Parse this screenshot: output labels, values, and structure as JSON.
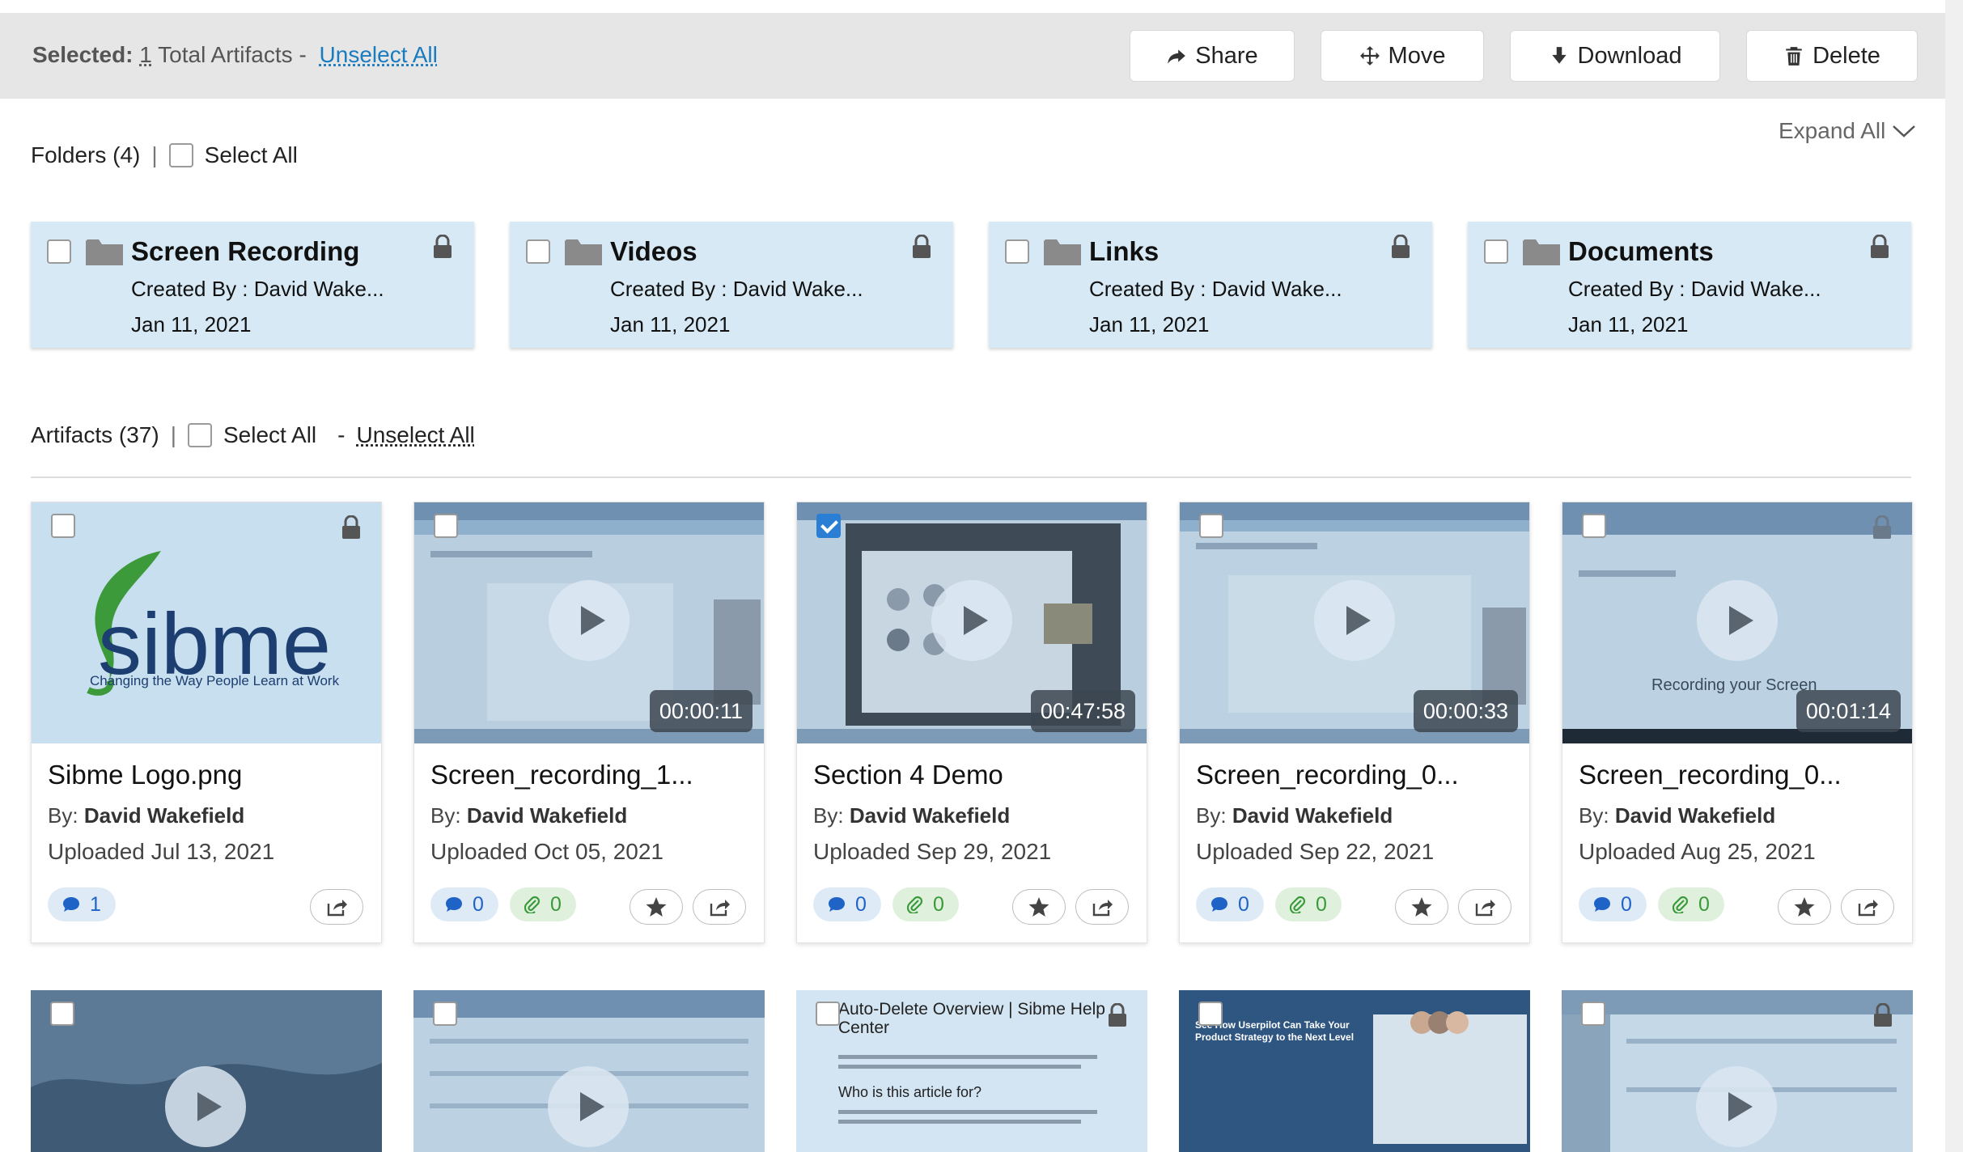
{
  "selection": {
    "label": "Selected:",
    "count": "1",
    "total_text": "Total Artifacts",
    "dash": "-",
    "unselect_all": "Unselect All",
    "actions": [
      {
        "label": "Share",
        "icon": "share-arrow-icon"
      },
      {
        "label": "Move",
        "icon": "move-arrows-icon"
      },
      {
        "label": "Download",
        "icon": "download-arrow-icon"
      },
      {
        "label": "Delete",
        "icon": "trash-icon"
      }
    ]
  },
  "folders_section": {
    "label": "Folders (4)",
    "select_all": "Select All",
    "expand_all": "Expand All",
    "folders": [
      {
        "title": "Screen Recording",
        "created_by": "Created By : David Wake...",
        "date": "Jan 11, 2021"
      },
      {
        "title": "Videos",
        "created_by": "Created By : David Wake...",
        "date": "Jan 11, 2021"
      },
      {
        "title": "Links",
        "created_by": "Created By : David Wake...",
        "date": "Jan 11, 2021"
      },
      {
        "title": "Documents",
        "created_by": "Created By : David Wake...",
        "date": "Jan 11, 2021"
      }
    ]
  },
  "artifacts_section": {
    "label": "Artifacts (37)",
    "select_all": "Select All",
    "dash": "-",
    "unselect_all": "Unselect All",
    "by_prefix": "By:",
    "cards": [
      {
        "title": "Sibme Logo.png",
        "author": "David Wakefield",
        "uploaded": "Uploaded Jul 13, 2021",
        "duration": "",
        "comments": "1",
        "attachments": "",
        "checked": false,
        "logo_word": "sibme",
        "logo_tagline": "Changing the Way People Learn at Work"
      },
      {
        "title": "Screen_recording_1...",
        "author": "David Wakefield",
        "uploaded": "Uploaded Oct 05, 2021",
        "duration": "00:00:11",
        "comments": "0",
        "attachments": "0",
        "checked": false
      },
      {
        "title": "Section 4 Demo",
        "author": "David Wakefield",
        "uploaded": "Uploaded Sep 29, 2021",
        "duration": "00:47:58",
        "comments": "0",
        "attachments": "0",
        "checked": true
      },
      {
        "title": "Screen_recording_0...",
        "author": "David Wakefield",
        "uploaded": "Uploaded Sep 22, 2021",
        "duration": "00:00:33",
        "comments": "0",
        "attachments": "0",
        "checked": false
      },
      {
        "title": "Screen_recording_0...",
        "author": "David Wakefield",
        "uploaded": "Uploaded Aug 25, 2021",
        "duration": "00:01:14",
        "comments": "0",
        "attachments": "0",
        "checked": false,
        "thumb_caption": "Recording your Screen"
      }
    ],
    "second_row": [
      {
        "kind": "video"
      },
      {
        "kind": "video"
      },
      {
        "kind": "doc",
        "heading": "Auto-Delete Overview | Sibme Help Center",
        "subheading": "Who is this article for?"
      },
      {
        "kind": "doc",
        "heading": "See How Userpilot Can Take Your Product Strategy to the Next Level"
      },
      {
        "kind": "video"
      }
    ]
  },
  "colors": {
    "accent": "#1a7bbf",
    "folder_bg": "#d6e9f5",
    "selbar_bg": "#e6e6e6",
    "checkbox_checked": "#2a7fd4",
    "comment_pill": "#deebf7",
    "attach_pill": "#dff0dd"
  }
}
